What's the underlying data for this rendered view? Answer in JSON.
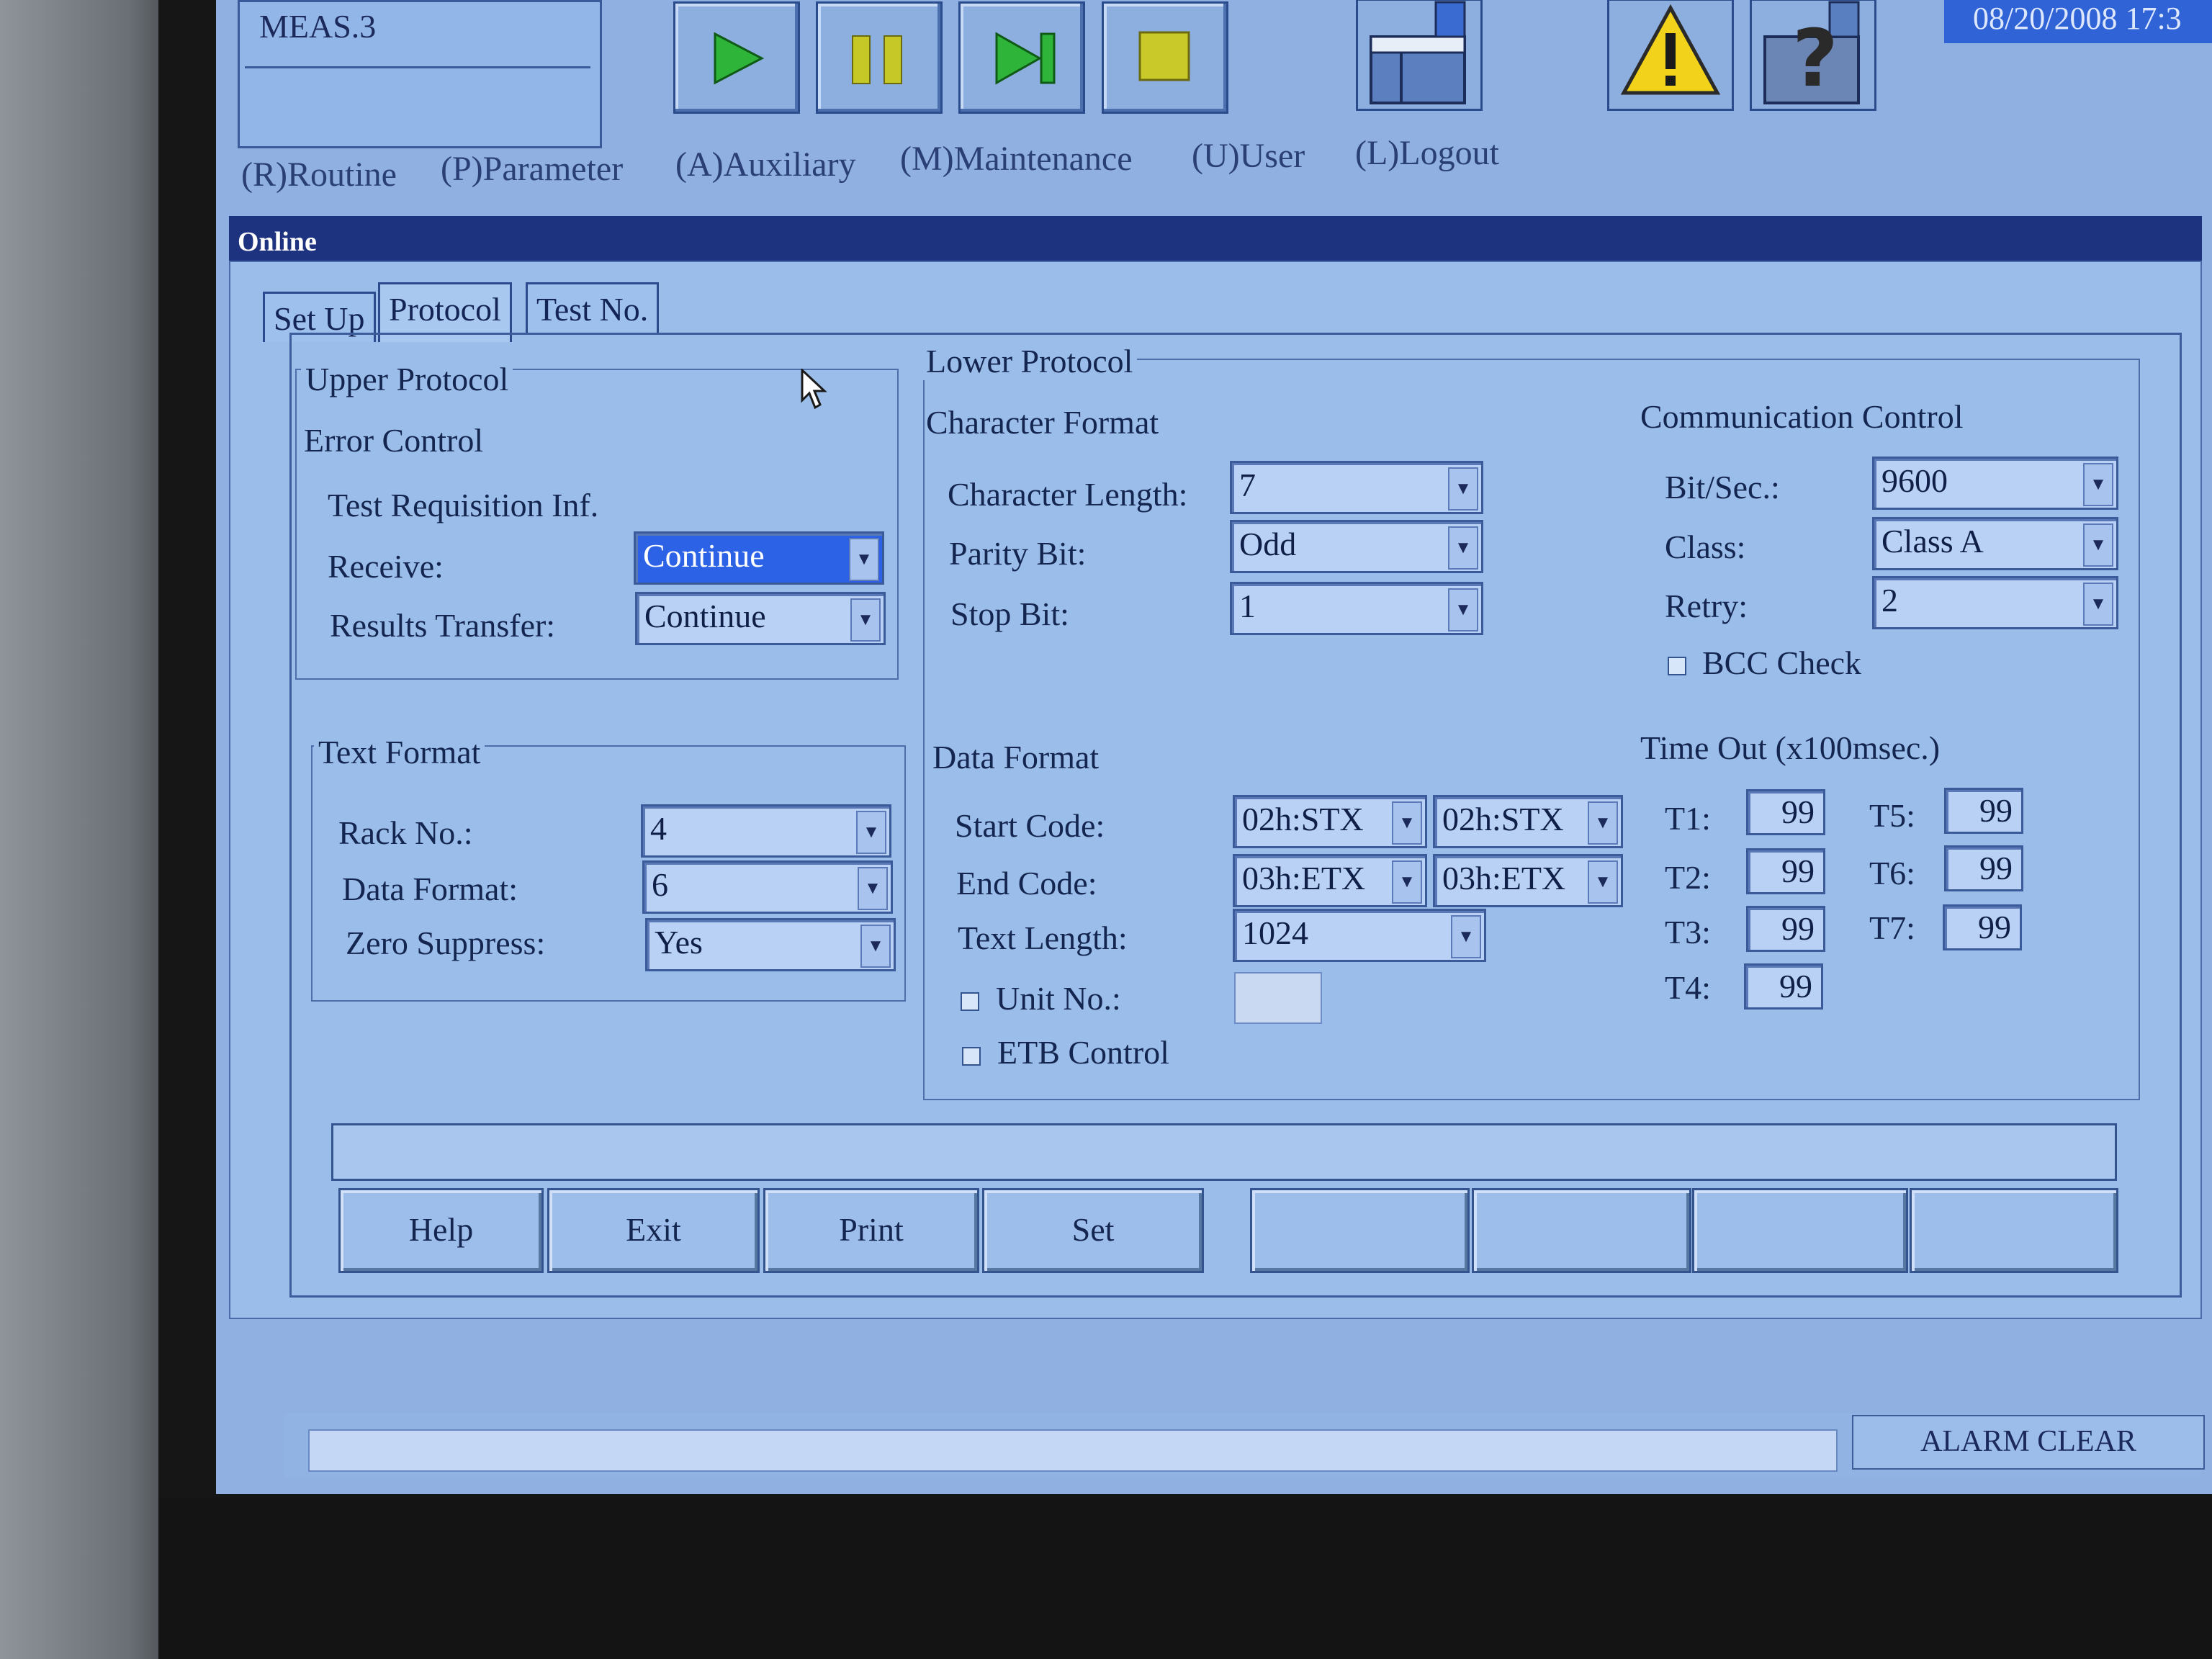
{
  "header": {
    "meas_label": "MEAS.3",
    "datetime": "08/20/2008 17:3"
  },
  "toolbar": {
    "play_icon": "play-icon",
    "pause_icon": "pause-icon",
    "step_icon": "step-forward-icon",
    "stop_icon": "stop-icon",
    "analyzer_icon": "analyzer-icon",
    "warning_icon": "warning-icon",
    "help_icon": "help-analyzer-icon",
    "accent_color": "#2fb43a",
    "warning_color": "#f2d21a"
  },
  "menu": [
    "(R)Routine",
    "(P)Parameter",
    "(A)Auxiliary",
    "(M)Maintenance",
    "(U)User",
    "(L)Logout"
  ],
  "window": {
    "title": "Online",
    "tabs": [
      "Set Up",
      "Protocol",
      "Test No."
    ]
  },
  "upper_protocol": {
    "title": "Upper Protocol",
    "error_control": "Error Control",
    "test_requisition": "Test Requisition Inf.",
    "receive_label": "Receive:",
    "receive_value": "Continue",
    "results_label": "Results Transfer:",
    "results_value": "Continue"
  },
  "text_format": {
    "title": "Text Format",
    "rack_label": "Rack  No.:",
    "rack_value": "4",
    "data_format_label": "Data Format:",
    "data_format_value": "6",
    "zero_label": "Zero Suppress:",
    "zero_value": "Yes"
  },
  "lower_protocol": {
    "title": "Lower Protocol",
    "char_format_title": "Character Format",
    "char_length_label": "Character Length:",
    "char_length_value": "7",
    "parity_label": "Parity Bit:",
    "parity_value": "Odd",
    "stop_label": "Stop Bit:",
    "stop_value": "1",
    "data_format_title": "Data Format",
    "start_label": "Start Code:",
    "start_value_1": "02h:STX",
    "start_value_2": "02h:STX",
    "end_label": "End Code:",
    "end_value_1": "03h:ETX",
    "end_value_2": "03h:ETX",
    "text_length_label": "Text Length:",
    "text_length_value": "1024",
    "unit_label": "Unit No.:",
    "etb_label": "ETB Control"
  },
  "comm_control": {
    "title": "Communication Control",
    "bitsec_label": "Bit/Sec.:",
    "bitsec_value": "9600",
    "class_label": "Class:",
    "class_value": "Class A",
    "retry_label": "Retry:",
    "retry_value": "2",
    "bcc_label": "BCC Check"
  },
  "timeout": {
    "title": "Time Out (x100msec.)",
    "t1_label": "T1:",
    "t1": "99",
    "t2_label": "T2:",
    "t2": "99",
    "t3_label": "T3:",
    "t3": "99",
    "t4_label": "T4:",
    "t4": "99",
    "t5_label": "T5:",
    "t5": "99",
    "t6_label": "T6:",
    "t6": "99",
    "t7_label": "T7:",
    "t7": "99"
  },
  "buttons": {
    "help": "Help",
    "exit": "Exit",
    "print": "Print",
    "set": "Set"
  },
  "status": {
    "alarm_clear": "ALARM CLEAR"
  }
}
